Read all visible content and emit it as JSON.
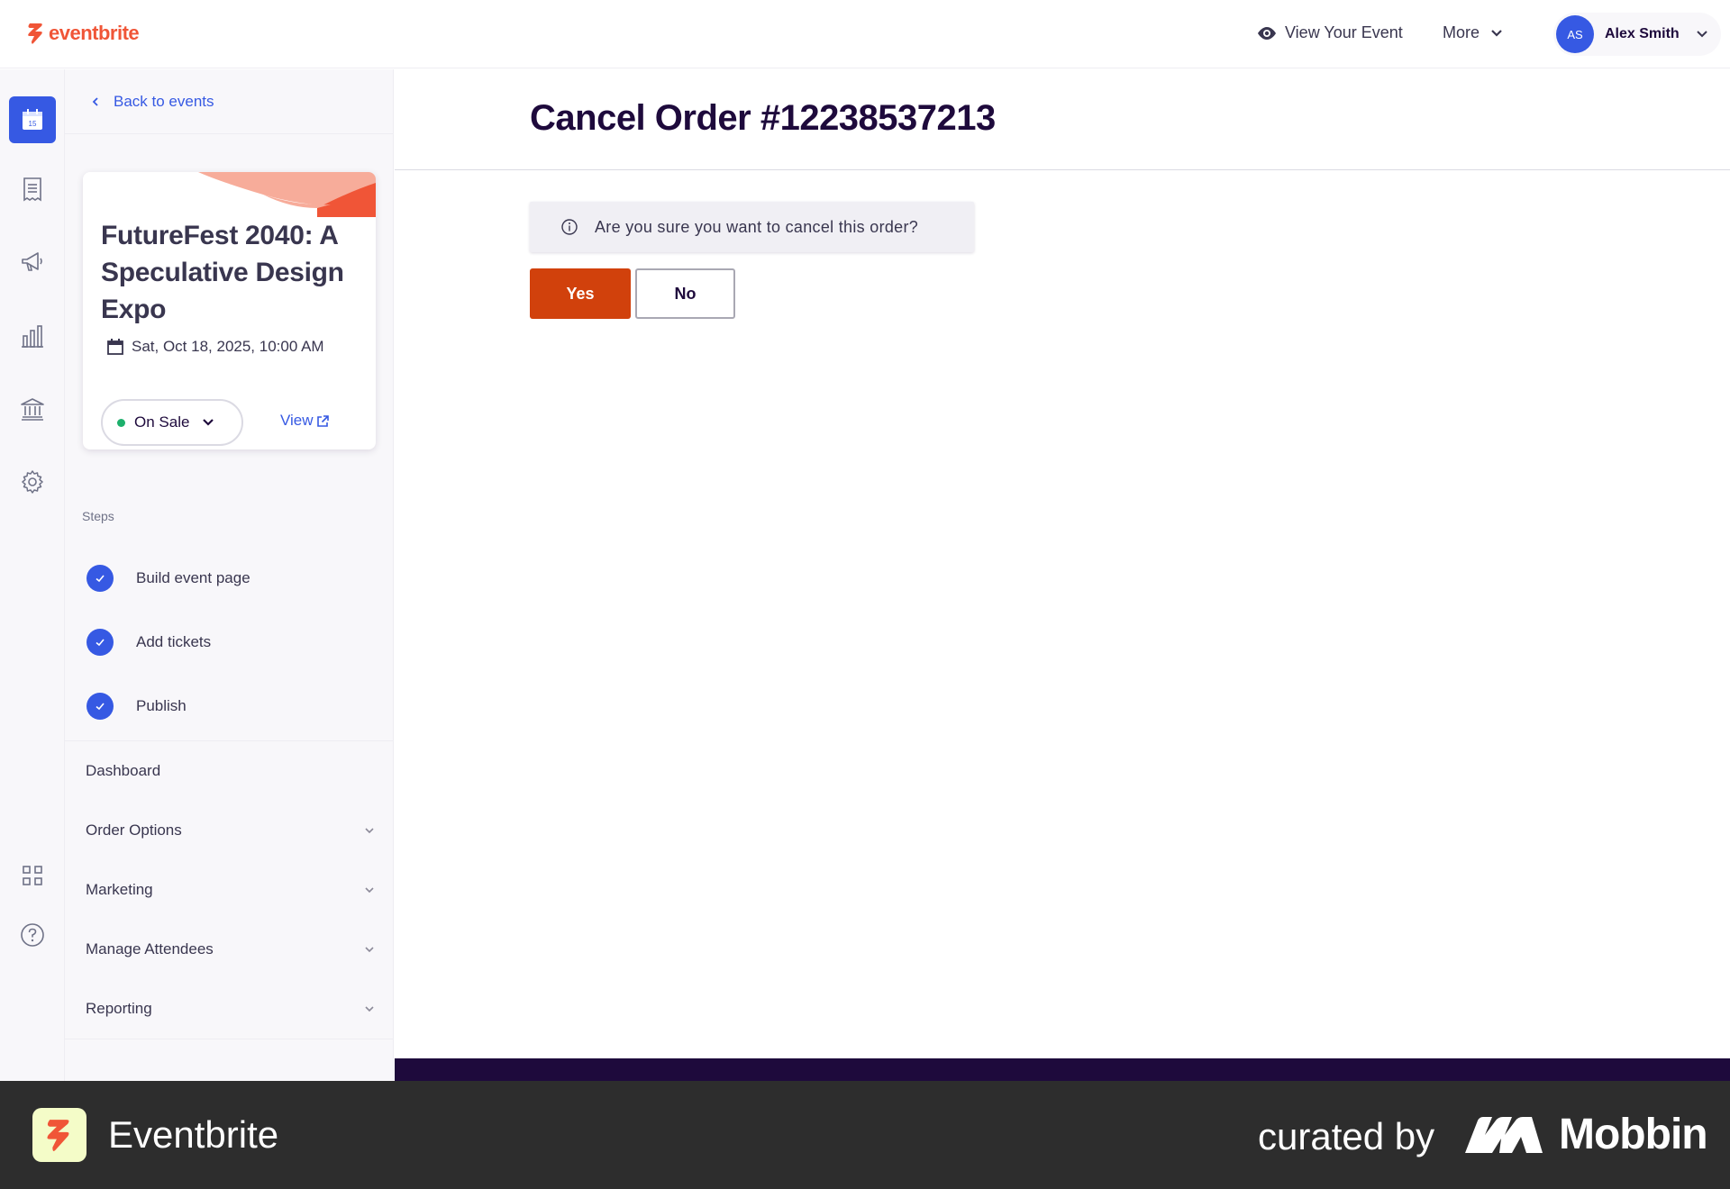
{
  "brand": {
    "logo_text": "eventbrite",
    "accent": "#f05537",
    "link_color": "#3659e3"
  },
  "topbar": {
    "view_event_label": "View Your Event",
    "more_label": "More",
    "user": {
      "initials": "AS",
      "name": "Alex Smith"
    }
  },
  "rail": {
    "icons": [
      "calendar-icon",
      "orders-icon",
      "megaphone-icon",
      "chart-icon",
      "bank-icon",
      "gear-icon",
      "apps-grid-icon",
      "help-icon"
    ],
    "active": "calendar-icon",
    "calendar_day": "15"
  },
  "sidebar": {
    "back_label": "Back to events",
    "event": {
      "title": "FutureFest 2040: A Speculative Design Expo",
      "date": "Sat, Oct 18, 2025, 10:00 AM",
      "status": "On Sale",
      "status_color": "#1db06c",
      "view_label": "View"
    },
    "steps_heading": "Steps",
    "steps": [
      {
        "label": "Build event page",
        "done": true
      },
      {
        "label": "Add tickets",
        "done": true
      },
      {
        "label": "Publish",
        "done": true
      }
    ],
    "nav": [
      {
        "label": "Dashboard",
        "expandable": false
      },
      {
        "label": "Order Options",
        "expandable": true
      },
      {
        "label": "Marketing",
        "expandable": true
      },
      {
        "label": "Manage Attendees",
        "expandable": true
      },
      {
        "label": "Reporting",
        "expandable": true
      }
    ]
  },
  "main": {
    "title": "Cancel Order #12238537213",
    "confirm_message": "Are you sure you want to cancel this order?",
    "yes_label": "Yes",
    "no_label": "No",
    "yes_color": "#d1410c"
  },
  "credit": {
    "app_name": "Eventbrite",
    "curated_label": "curated by",
    "mobbin_label": "Mobbin"
  }
}
